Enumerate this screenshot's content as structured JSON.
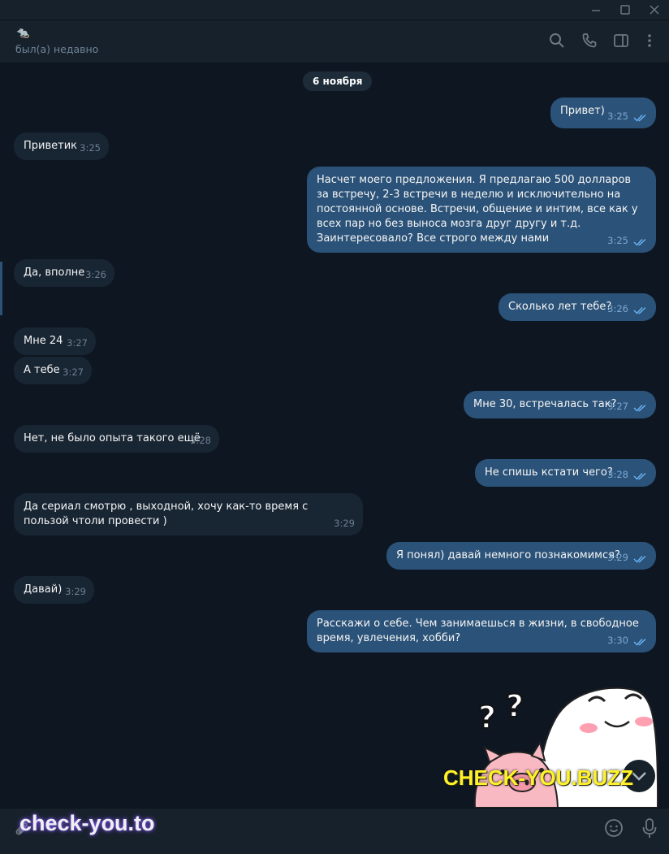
{
  "window": {
    "controls": [
      "minimize",
      "maximize",
      "close"
    ]
  },
  "header": {
    "avatar_emoji": "🐀",
    "status": "был(а) недавно",
    "icons": [
      "search-icon",
      "phone-icon",
      "sidebar-icon",
      "more-icon"
    ]
  },
  "chat": {
    "date": "6 ноября",
    "messages": [
      {
        "dir": "out",
        "text": "Привет)",
        "time": "3:25"
      },
      {
        "dir": "in",
        "text": "Приветик",
        "time": "3:25"
      },
      {
        "dir": "out",
        "text": "Насчет моего предложения. Я предлагаю 500 долларов за встречу, 2-3 встречи в неделю и исключительно на постоянной основе. Встречи, общение и интим, все как у всех пар но без выноса мозга друг другу и т.д. Заинтересовало? Все строго между нами",
        "time": "3:25"
      },
      {
        "dir": "in",
        "text": "Да, вполне",
        "time": "3:26"
      },
      {
        "dir": "out",
        "text": "Сколько лет тебе?",
        "time": "3:26"
      },
      {
        "dir": "in",
        "text": "Мне 24",
        "time": "3:27"
      },
      {
        "dir": "in",
        "text": "А тебе",
        "time": "3:27"
      },
      {
        "dir": "out",
        "text": "Мне 30, встречалась так?",
        "time": "3:27"
      },
      {
        "dir": "in",
        "text": "Нет, не было опыта такого ещё",
        "time": "3:28"
      },
      {
        "dir": "out",
        "text": "Не спишь кстати чего?",
        "time": "3:28"
      },
      {
        "dir": "in",
        "text": "Да сериал смотрю , выходной, хочу как-то время с пользой чтоли провести )",
        "time": "3:29"
      },
      {
        "dir": "out",
        "text": "Я понял) давай немного познакомимся?",
        "time": "3:29"
      },
      {
        "dir": "in",
        "text": "Давай)",
        "time": "3:29"
      },
      {
        "dir": "out",
        "text": "Расскажи о себе. Чем занимаешься в жизни, в свободное время, увлечения, хобби?",
        "time": "3:30"
      }
    ]
  },
  "watermarks": {
    "big": "CHECK-YOU.BUZZ",
    "small": "check-you.to"
  },
  "composer": {
    "icons": [
      "attach-icon",
      "emoji-icon",
      "mic-icon"
    ]
  },
  "colors": {
    "bg": "#0e1621",
    "panel": "#17212b",
    "in_bubble": "#182533",
    "out_bubble": "#2b5278",
    "accent": "#6ab3f3"
  }
}
